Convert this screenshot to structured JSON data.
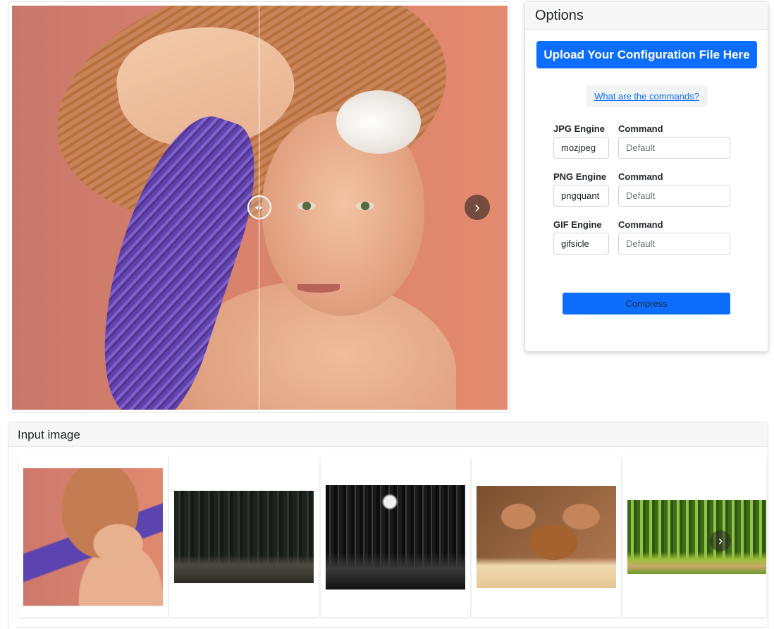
{
  "options": {
    "title": "Options",
    "upload_label": "Upload Your Configuration File Here",
    "commands_link": "What are the commands?",
    "engines": [
      {
        "engine_label": "JPG Engine",
        "command_label": "Command",
        "engine_value": "mozjpeg",
        "command_placeholder": "Default"
      },
      {
        "engine_label": "PNG Engine",
        "command_label": "Command",
        "engine_value": "pngquant",
        "command_placeholder": "Default"
      },
      {
        "engine_label": "GIF Engine",
        "command_label": "Command",
        "engine_value": "gifsicle",
        "command_placeholder": "Default"
      }
    ],
    "compress_label": "Compress"
  },
  "input_section": {
    "title": "Input image"
  },
  "icons": {
    "viewer_next": "chevron-right-icon",
    "compare_handle": "compare-slider-icon",
    "strip_next": "chevron-right-icon"
  },
  "colors": {
    "primary": "#0d6efd",
    "card_header": "#f7f7f7",
    "border": "#dee2e6"
  }
}
